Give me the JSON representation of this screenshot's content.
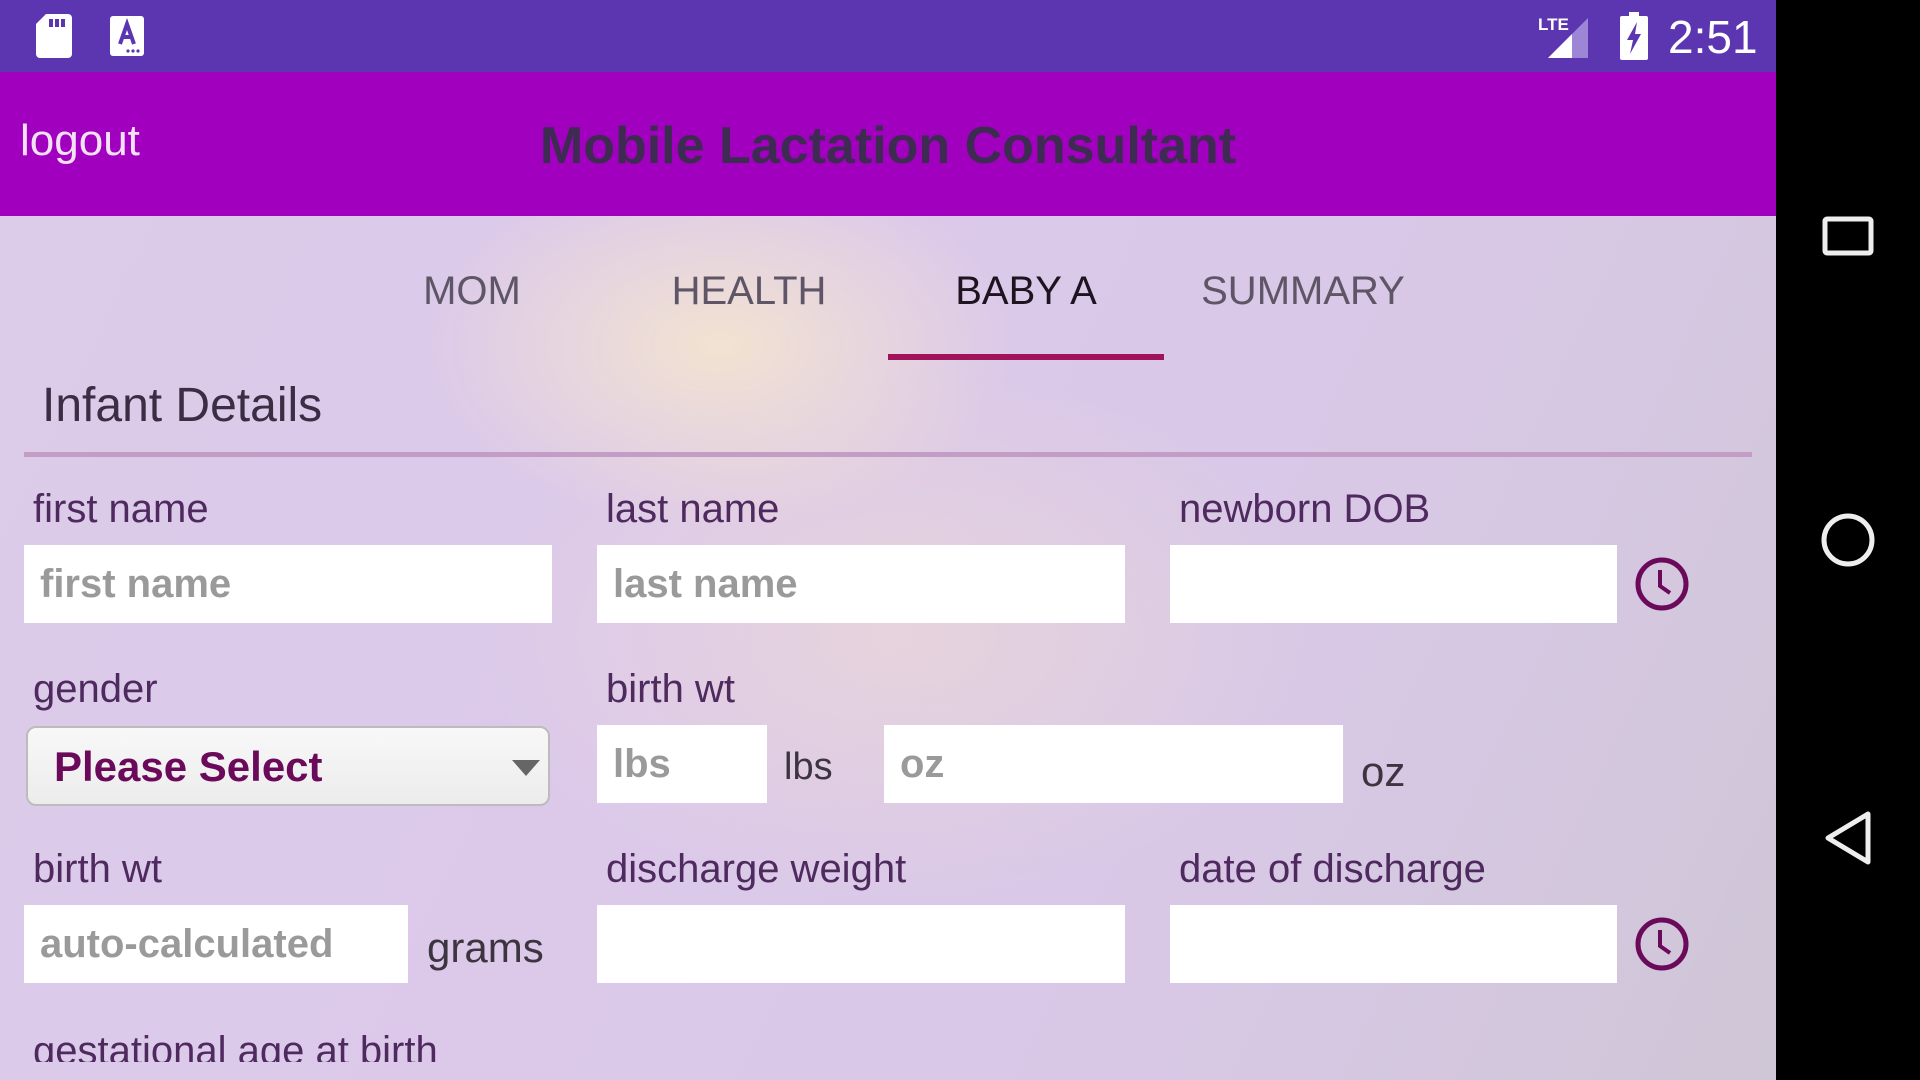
{
  "status_bar": {
    "icons": [
      "sd-card-icon",
      "font-download-icon",
      "lte-signal-icon",
      "battery-charging-icon"
    ],
    "network_label": "LTE",
    "time": "2:51",
    "color": "#5c35b1"
  },
  "app_bar": {
    "logout_label": "logout",
    "title": "Mobile Lactation Consultant",
    "color": "#a200bf"
  },
  "tabs": [
    {
      "label": "MOM",
      "active": false
    },
    {
      "label": "HEALTH",
      "active": false
    },
    {
      "label": "BABY A",
      "active": true
    },
    {
      "label": "SUMMARY",
      "active": false
    }
  ],
  "accent_color": "#a0125a",
  "section": {
    "title": "Infant Details"
  },
  "form": {
    "first_name": {
      "label": "first name",
      "placeholder": "first name",
      "value": ""
    },
    "last_name": {
      "label": "last name",
      "placeholder": "last name",
      "value": ""
    },
    "newborn_dob": {
      "label": "newborn DOB",
      "value": "",
      "icon": "clock-icon"
    },
    "gender": {
      "label": "gender",
      "selected": "Please Select"
    },
    "birth_wt_lbs_oz": {
      "label": "birth wt",
      "lbs_placeholder": "lbs",
      "lbs_unit": "lbs",
      "oz_placeholder": "oz",
      "oz_unit": "oz"
    },
    "birth_wt_grams": {
      "label": "birth wt",
      "placeholder": "auto-calculated",
      "unit": "grams"
    },
    "discharge_weight": {
      "label": "discharge weight",
      "value": ""
    },
    "date_of_discharge": {
      "label": "date of discharge",
      "value": "",
      "icon": "clock-icon"
    },
    "gestational_age": {
      "label": "gestational age at birth"
    }
  },
  "nav_bar": {
    "buttons": [
      "recents-button",
      "home-button",
      "back-button"
    ]
  }
}
